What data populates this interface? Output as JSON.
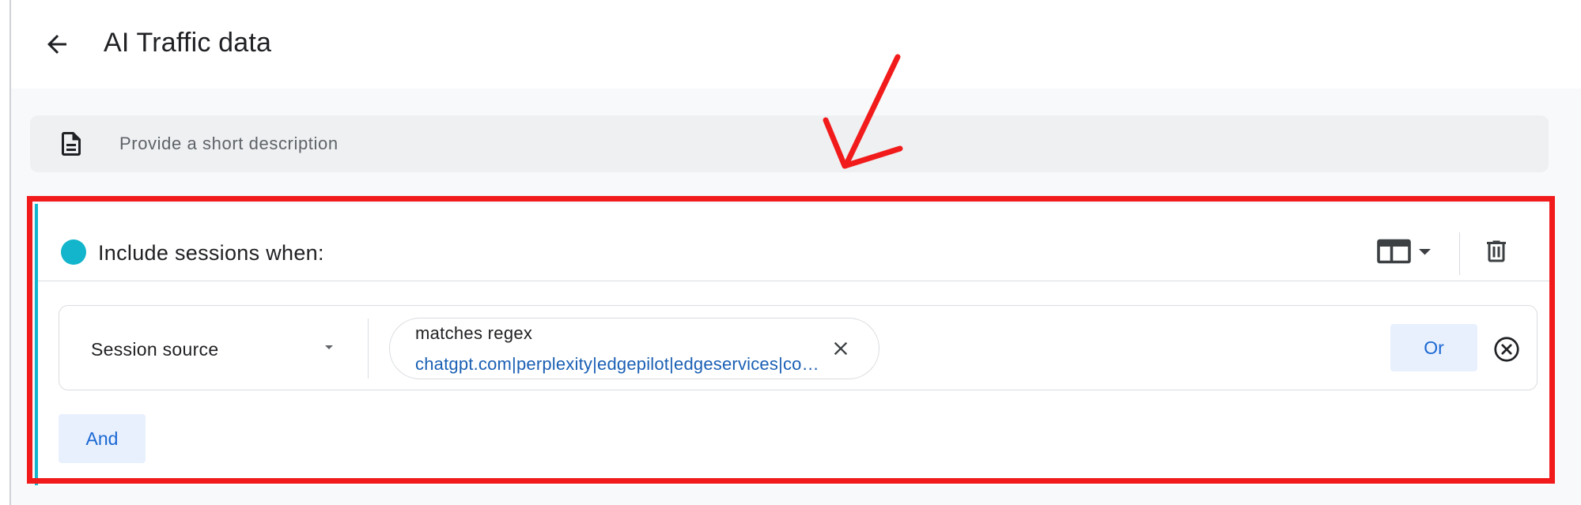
{
  "header": {
    "title": "AI Traffic data"
  },
  "description": {
    "placeholder": "Provide a short description"
  },
  "condition_group": {
    "heading": "Include sessions when:",
    "rows": [
      {
        "dimension": "Session source",
        "operator": "matches regex",
        "value": "chatgpt.com|perplexity|edgepilot|edgeservices|copilot.microsoft.com|gemini.google.com",
        "or_label": "Or"
      }
    ],
    "and_label": "And"
  },
  "colors": {
    "accent": "#12b5cb",
    "link": "#1a5fb4",
    "button_bg": "#e8f0fe",
    "highlight": "#f21b1b"
  },
  "icons": [
    "back-arrow-icon",
    "document-icon",
    "layout-icon",
    "trash-icon",
    "close-icon",
    "remove-circle-icon",
    "annotation-arrow-icon"
  ]
}
